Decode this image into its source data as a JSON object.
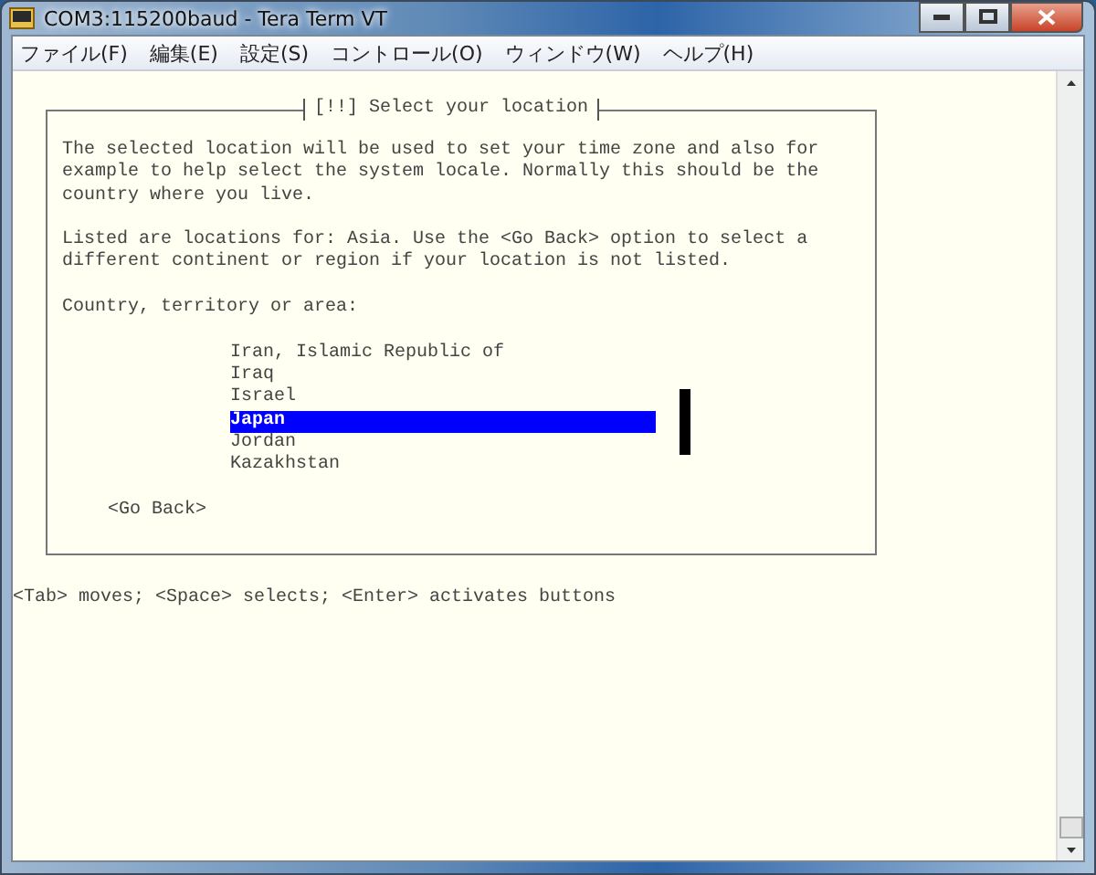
{
  "window": {
    "title": "COM3:115200baud - Tera Term VT"
  },
  "menu": [
    "ファイル(F)",
    "編集(E)",
    "設定(S)",
    "コントロール(O)",
    "ウィンドウ(W)",
    "ヘルプ(H)"
  ],
  "dialog": {
    "title": "[!!] Select your location",
    "paragraphs": [
      "The selected location will be used to set your time zone and also for\nexample to help select the system locale. Normally this should be the\ncountry where you live.",
      "Listed are locations for: Asia. Use the <Go Back> option to select a\ndifferent continent or region if your location is not listed."
    ],
    "prompt": "Country, territory or area:",
    "options": [
      {
        "label": "Iran, Islamic Republic of",
        "selected": false
      },
      {
        "label": "Iraq",
        "selected": false
      },
      {
        "label": "Israel",
        "selected": false
      },
      {
        "label": "Japan",
        "selected": true
      },
      {
        "label": "Jordan",
        "selected": false
      },
      {
        "label": "Kazakhstan",
        "selected": false
      }
    ],
    "go_back": "<Go Back>"
  },
  "hint": "<Tab> moves; <Space> selects; <Enter> activates buttons"
}
